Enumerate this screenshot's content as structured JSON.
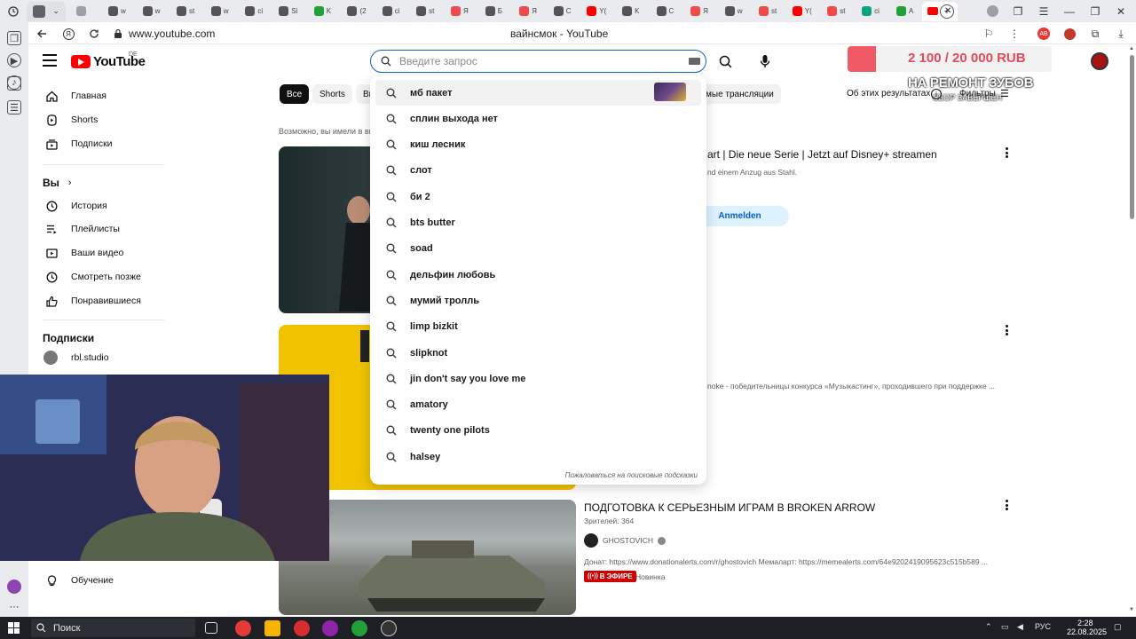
{
  "browser": {
    "tabs": [
      {
        "label": "",
        "color": "#9aa0a6"
      },
      {
        "label": "w",
        "color": "#555555"
      },
      {
        "label": "w",
        "color": "#555555"
      },
      {
        "label": "st",
        "color": "#555555"
      },
      {
        "label": "w",
        "color": "#555555"
      },
      {
        "label": "ci",
        "color": "#555555"
      },
      {
        "label": "Si",
        "color": "#555555"
      },
      {
        "label": "K",
        "color": "#21a038"
      },
      {
        "label": "(2",
        "color": "#555555"
      },
      {
        "label": "ci",
        "color": "#555555"
      },
      {
        "label": "st",
        "color": "#555555"
      },
      {
        "label": "Я",
        "color": "#f04b4b"
      },
      {
        "label": "Б",
        "color": "#555555"
      },
      {
        "label": "Я",
        "color": "#f04b4b"
      },
      {
        "label": "С",
        "color": "#555555"
      },
      {
        "label": "Y(",
        "color": "#ff0000"
      },
      {
        "label": "K",
        "color": "#555555"
      },
      {
        "label": "С",
        "color": "#555555"
      },
      {
        "label": "Я",
        "color": "#f04b4b"
      },
      {
        "label": "w",
        "color": "#555555"
      },
      {
        "label": "st",
        "color": "#f04b4b"
      },
      {
        "label": "Y(",
        "color": "#ff0000"
      },
      {
        "label": "st",
        "color": "#f04b4b"
      },
      {
        "label": "ci",
        "color": "#10a37f"
      },
      {
        "label": "A",
        "color": "#21a038"
      }
    ],
    "url": "www.youtube.com",
    "page_title": "вайнсмок - YouTube"
  },
  "youtube": {
    "logo_text": "YouTube",
    "region": "DE",
    "search": {
      "placeholder": "Введите запрос",
      "value": ""
    }
  },
  "donation": {
    "amount": "2 100 / 20 000 RUB",
    "title": "НА РЕМОНТ ЗУБОВ",
    "status": "СБОР ЗАВЕРШЕН",
    "progress_fraction": 0.105,
    "fill_color": "#f05a66"
  },
  "guide": {
    "main": [
      {
        "label": "Главная",
        "icon": "home-icon"
      },
      {
        "label": "Shorts",
        "icon": "shorts-icon"
      },
      {
        "label": "Подписки",
        "icon": "subscriptions-icon"
      }
    ],
    "you_heading": "Вы",
    "you": [
      {
        "label": "История",
        "icon": "history-icon"
      },
      {
        "label": "Плейлисты",
        "icon": "playlists-icon"
      },
      {
        "label": "Ваши видео",
        "icon": "your-videos-icon"
      },
      {
        "label": "Смотреть позже",
        "icon": "watch-later-icon"
      },
      {
        "label": "Понравившиеся",
        "icon": "liked-icon"
      }
    ],
    "subs_heading": "Подписки",
    "subs": [
      {
        "label": "rbl.studio"
      }
    ],
    "explore": [
      {
        "label": "Обучение",
        "icon": "learning-icon"
      }
    ]
  },
  "chips": [
    "Все",
    "Shorts",
    "Ви"
  ],
  "chip_partial": "мые трансляции",
  "about_results": "Об этих результатах",
  "filters_label": "Фильтры",
  "did_you_mean": "Возможно, вы имели в вид",
  "results": [
    {
      "title": "art | Die neue Serie | Jetzt auf Disney+ streamen",
      "meta": "nd einem Anzug aus Stahl.",
      "cta": "Anmelden"
    },
    {
      "title": "",
      "meta": "noke - победительницы конкурса «Музыкастинг», проходившего при поддержке ..."
    },
    {
      "title": "ПОДГОТОВКА К СЕРЬЕЗНЫМ ИГРАМ В BROKEN ARROW",
      "views": "Зрителей: 364",
      "channel": "GHOSTOVICH",
      "description": "Донат: https://www.donationalerts.com/r/ghostovich Мемаларт: https://memealerts.com/64e9202419095623c515b589 ...",
      "live_badge": "В ЭФИРЕ",
      "new_badge": "Новинка"
    }
  ],
  "suggestions": {
    "items": [
      "мб пакет",
      "сплин выхода нет",
      "киш лесник",
      "слот",
      "би 2",
      "bts butter",
      "soad",
      "дельфин любовь",
      "мумий тролль",
      "limp bizkit",
      "slipknot",
      "jin don't say you love me",
      "amatory",
      "twenty one pilots",
      "halsey"
    ],
    "report_label": "Пожаловаться на поисковые подсказки"
  },
  "taskbar": {
    "search_label": "Поиск",
    "language": "РУС",
    "time": "2:28",
    "date": "22.08.2025"
  }
}
